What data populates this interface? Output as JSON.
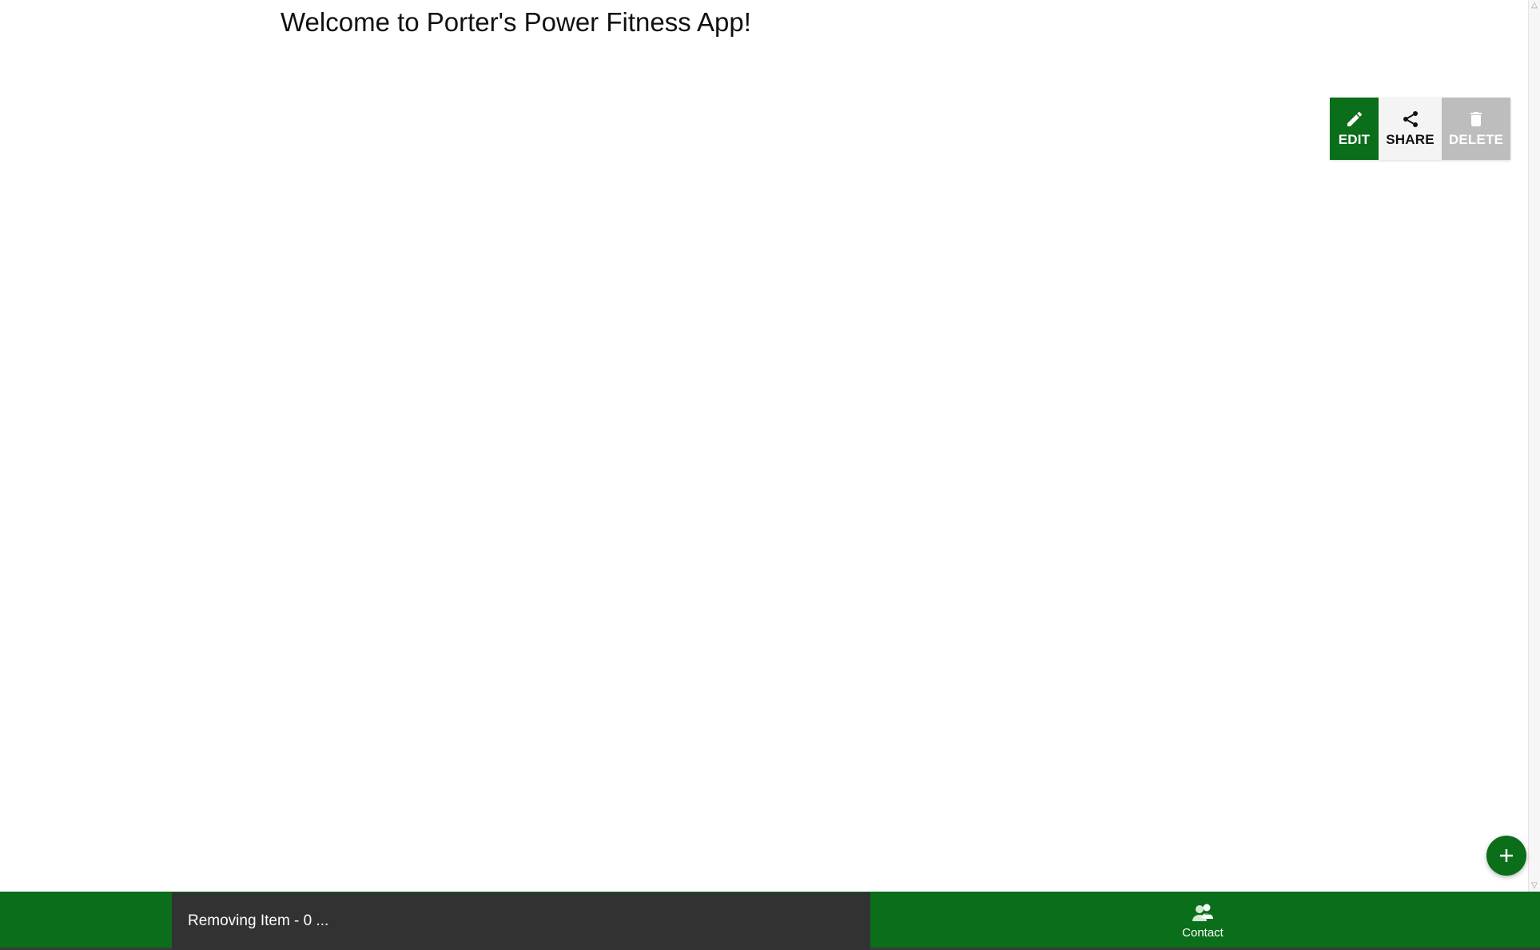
{
  "header": {
    "title": "Welcome to Porter's Power Fitness App!"
  },
  "actions": {
    "edit_label": "EDIT",
    "edit_icon": "pencil-icon",
    "share_label": "SHARE",
    "share_icon": "share-icon",
    "delete_label": "DELETE",
    "delete_icon": "trash-icon"
  },
  "fab": {
    "icon": "plus-icon"
  },
  "snackbar": {
    "message": "Removing Item - 0 ..."
  },
  "bottom_nav": {
    "contact_label": "Contact",
    "contact_icon": "contacts-icon"
  },
  "colors": {
    "brand_green": "#0a6e1a",
    "snackbar_bg": "#323232",
    "delete_disabled": "#bdbdbd"
  }
}
